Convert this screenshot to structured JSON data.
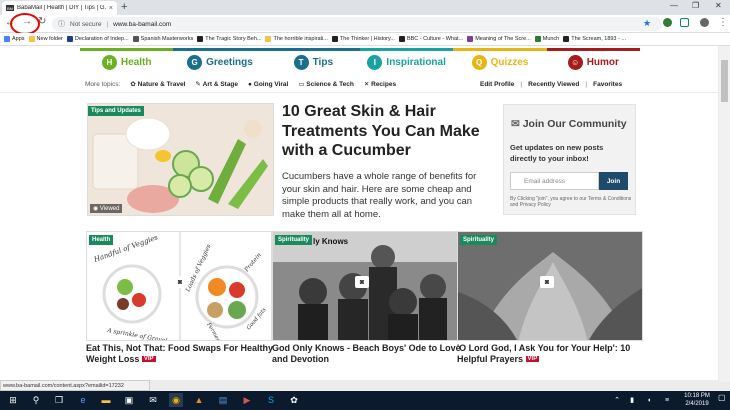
{
  "browser": {
    "tab_title": "BabaMail | Health | DIY | Tips | G...",
    "tab_favicon": "BM",
    "tab_close": "×",
    "new_tab": "+",
    "security": "Not secure",
    "url": "www.ba-bamail.com",
    "bookmarks": [
      {
        "label": "Apps",
        "color": "#4285f4"
      },
      {
        "label": "New folder",
        "color": "#f6c343"
      },
      {
        "label": "Declaration of Indep...",
        "color": "#1e3f8a"
      },
      {
        "label": "Spanish Masterworks",
        "color": "#555555"
      },
      {
        "label": "The Tragic Story Beh...",
        "color": "#222222"
      },
      {
        "label": "The horrible inspirati...",
        "color": "#f6c343"
      },
      {
        "label": "The Thinker | History...",
        "color": "#222222"
      },
      {
        "label": "BBC - Culture - What...",
        "color": "#222222"
      },
      {
        "label": "Meaning of The Scre...",
        "color": "#7b3fa0"
      },
      {
        "label": "Munch",
        "color": "#2e7d32"
      },
      {
        "label": "The Scream, 1893 - ...",
        "color": "#222222"
      }
    ],
    "status_url": "www.ba-bamail.com/content.aspx?emailid=17232"
  },
  "nav": {
    "tabs": [
      {
        "label": "Health",
        "color": "#6ab023",
        "icon": "H"
      },
      {
        "label": "Greetings",
        "color": "#1a6e8e",
        "icon": "G"
      },
      {
        "label": "Tips",
        "color": "#1a6e8e",
        "icon": "T"
      },
      {
        "label": "Inspirational",
        "color": "#1aa1a1",
        "icon": "I"
      },
      {
        "label": "Quizzes",
        "color": "#e8b514",
        "icon": "Q"
      },
      {
        "label": "Humor",
        "color": "#a61b1b",
        "icon": "☺"
      }
    ],
    "more_topics_label": "More topics:",
    "topics": [
      "Nature & Travel",
      "Art & Stage",
      "Going Viral",
      "Science & Tech",
      "Recipes"
    ],
    "user_links": [
      "Edit Profile",
      "Recently Viewed",
      "Favorites"
    ]
  },
  "featured": {
    "tag": "Tips and Updates",
    "viewed": "Viewed",
    "title": "10 Great Skin & Hair Treatments You Can Make with a Cucumber",
    "description": "Cucumbers have a whole range of benefits for your skin and hair. Here are some cheap and simple products that really work, and you can make them all at home."
  },
  "community": {
    "title": "Join Our Community",
    "description": "Get updates on new posts directly to your inbox!",
    "email_placeholder": "Email address",
    "join_label": "Join",
    "legal": "By Clicking \"join\", you agree to our Terms & Conditions and Privacy Policy"
  },
  "cards": [
    {
      "tag": "Health",
      "title": "Eat This, Not That: Food Swaps For Healthy Weight Loss",
      "vip": "VIP",
      "img_text": [
        "Handful of Veggies",
        "Loads of Veggies",
        "Protein",
        "Fermented food",
        "Good fats",
        "A sprinkle of Gravel"
      ]
    },
    {
      "tag": "Spirituality",
      "title": "God Only Knows - Beach Boys' Ode to Love and Devotion",
      "vip": "",
      "img_text": [
        "ly Knows"
      ]
    },
    {
      "tag": "Spirituality",
      "title": "'O Lord God, I Ask You for Your Help': 10 Helpful Prayers",
      "vip": "VIP",
      "img_text": []
    }
  ],
  "taskbar": {
    "time": "10:18 PM",
    "date": "2/4/2019"
  }
}
